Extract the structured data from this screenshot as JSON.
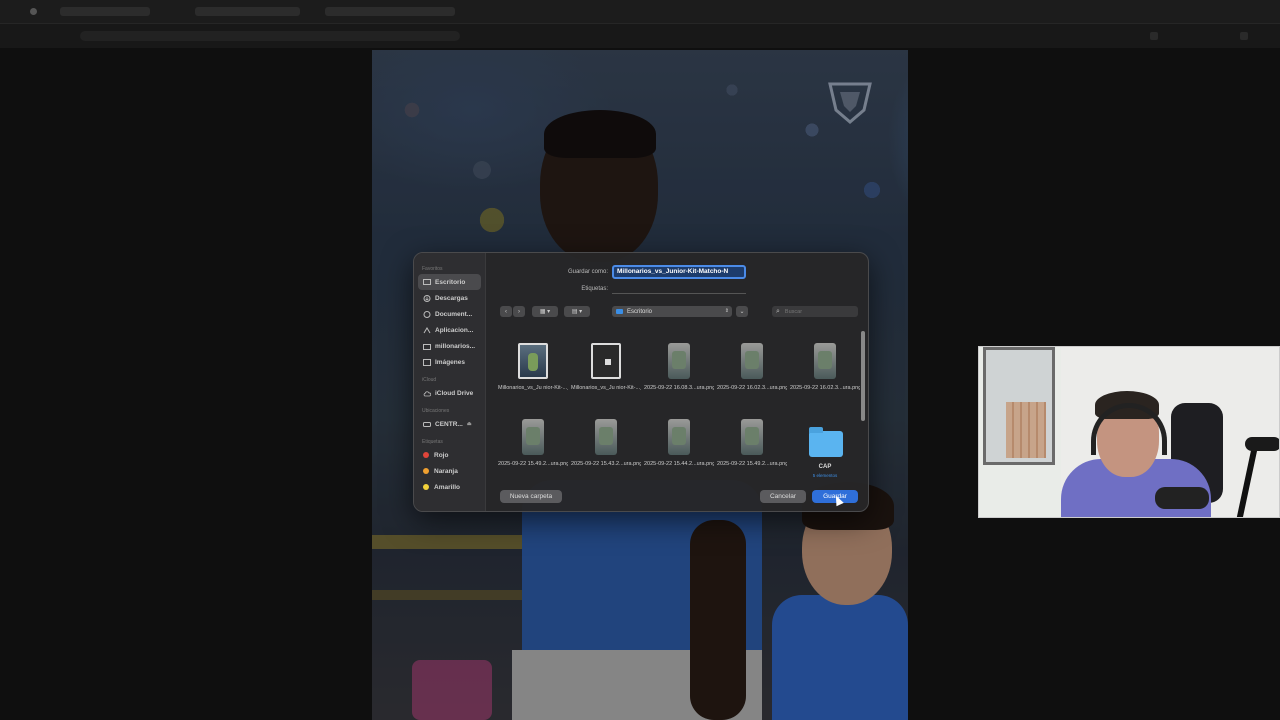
{
  "dialog": {
    "save_as_label": "Guardar como:",
    "filename": "Millonarios_vs_Junior-Kit-Matcho-N",
    "tags_label": "Etiquetas:",
    "location": "Escritorio",
    "search_placeholder": "Buscar",
    "new_folder_button": "Nueva carpeta",
    "cancel_button": "Cancelar",
    "save_button": "Guardar"
  },
  "sidebar": {
    "favorites_header": "Favoritos",
    "favorites": [
      {
        "label": "Escritorio",
        "icon": "desktop-icon"
      },
      {
        "label": "Descargas",
        "icon": "download-icon"
      },
      {
        "label": "Document...",
        "icon": "document-icon"
      },
      {
        "label": "Aplicacion...",
        "icon": "apps-icon"
      },
      {
        "label": "millonarios...",
        "icon": "folder-icon"
      },
      {
        "label": "Imágenes",
        "icon": "photo-icon"
      }
    ],
    "icloud_header": "iCloud",
    "icloud": [
      {
        "label": "iCloud Drive",
        "icon": "cloud-icon"
      }
    ],
    "locations_header": "Ubicaciones",
    "locations": [
      {
        "label": "CENTR...",
        "icon": "disk-icon"
      }
    ],
    "tags_header": "Etiquetas",
    "tags": [
      {
        "label": "Rojo",
        "color": "#e0453a"
      },
      {
        "label": "Naranja",
        "color": "#f0a030"
      },
      {
        "label": "Amarillo",
        "color": "#f2d13a"
      }
    ]
  },
  "files": [
    {
      "name": "Millonarios_vs_Ju nior-Kit-..._439.jpg",
      "kind": "image1"
    },
    {
      "name": "Millonarios_vs_Ju nior-Kit-..._430.jpg",
      "kind": "image2"
    },
    {
      "name": "2025-09-22 16.08.3...ura.png",
      "kind": "shot"
    },
    {
      "name": "2025-09-22 16.02.3...ura.png",
      "kind": "shot"
    },
    {
      "name": "2025-09-22 16.02.3...ura.png",
      "kind": "shot"
    },
    {
      "name": "2025-09-22 15.49.2...ura.png",
      "kind": "shot"
    },
    {
      "name": "2025-09-22 15.43.2...ura.png",
      "kind": "shot"
    },
    {
      "name": "2025-09-22 15.44.2...ura.png",
      "kind": "shot"
    },
    {
      "name": "2025-09-22 15.49.2...ura.png",
      "kind": "shot"
    },
    {
      "name": "CAP",
      "kind": "folder",
      "sub": "5 elementos"
    }
  ],
  "colors": {
    "accent": "#2f6fd9",
    "folder": "#5ab4f0",
    "jersey": "#2e5fae"
  }
}
